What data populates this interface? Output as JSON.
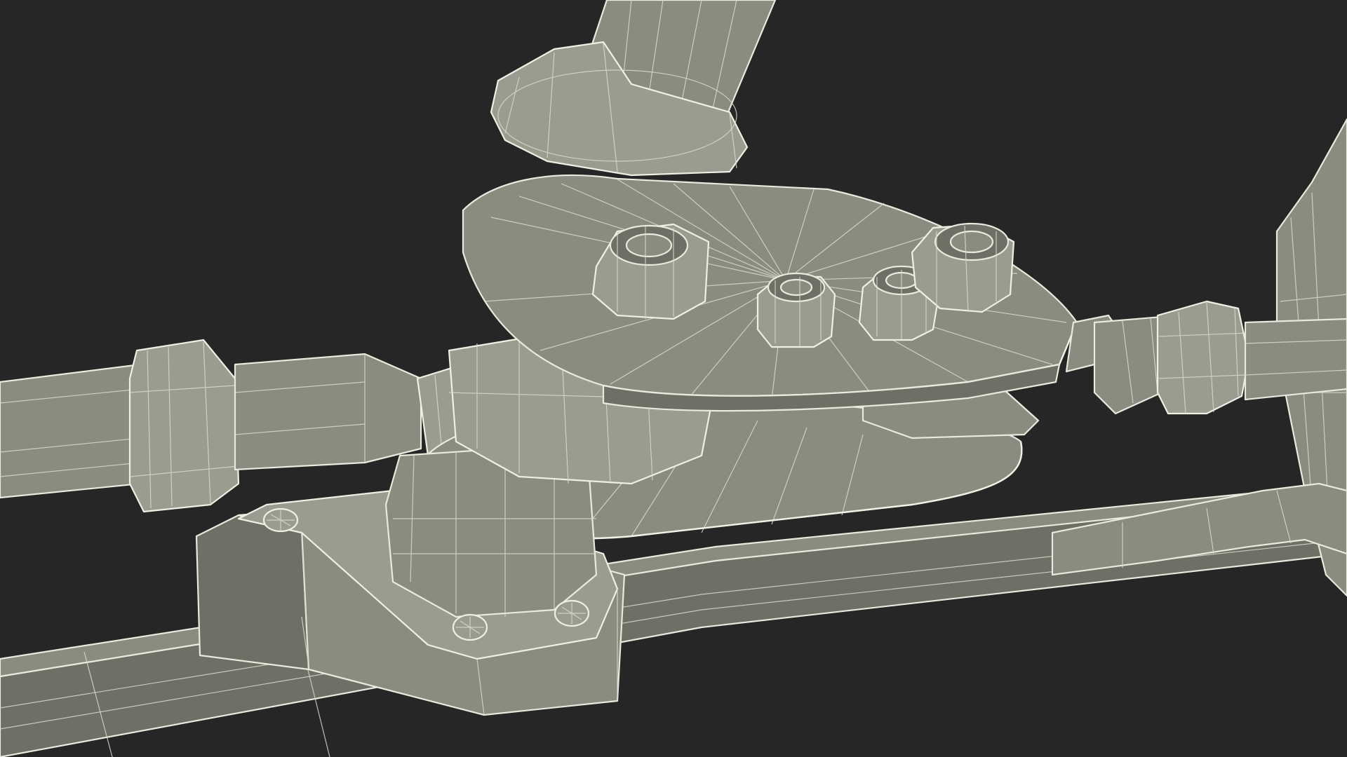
{
  "scene": {
    "background_color": "#262626",
    "mesh_fill_color": "#8b8b80",
    "wireframe_color": "#e9e9dd",
    "render_style": "wireframe-on-shaded"
  },
  "parts": {
    "left_rod": "rod",
    "right_rod": "rod",
    "upper_rod": "rod",
    "top_plate": "plate",
    "bottom_plate": "plate",
    "base_bracket": "bracket",
    "rail": "rail",
    "bolts": [
      "bolt",
      "bolt",
      "bolt",
      "bolt"
    ],
    "rivets": [
      "rivet",
      "rivet",
      "rivet"
    ]
  }
}
